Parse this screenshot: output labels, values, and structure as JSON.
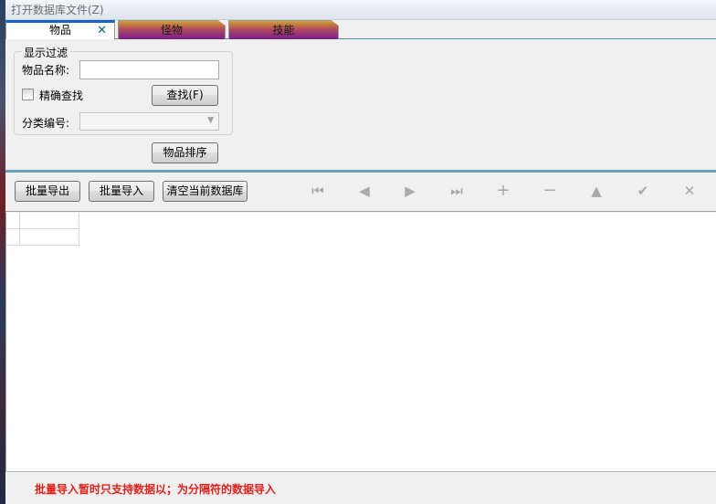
{
  "menu": {
    "title": "打开数据库文件(Z)"
  },
  "tabs": [
    {
      "label": "物品",
      "close": "✕"
    },
    {
      "label": "怪物"
    },
    {
      "label": "技能"
    }
  ],
  "filter": {
    "legend": "显示过滤",
    "name_label": "物品名称:",
    "name_value": "",
    "exact_label": "精确查找",
    "exact_checked": false,
    "search_button": "查找(F)",
    "category_label": "分类编号:",
    "category_value": "",
    "sort_button": "物品排序"
  },
  "toolbar": {
    "export_button": "批量导出",
    "import_button": "批量导入",
    "clear_button": "清空当前数据库",
    "nav_icons": [
      "first-icon",
      "prior-icon",
      "next-icon",
      "last-icon",
      "insert-icon",
      "delete-icon",
      "edit-icon",
      "post-icon",
      "cancel-icon"
    ]
  },
  "status": {
    "message": "批量导入暂时只支持数据以；为分隔符的数据导入"
  },
  "colors": {
    "accent": "#4a8fa6",
    "status_text": "#e0201a",
    "active_tab_top": "#1563c9"
  }
}
